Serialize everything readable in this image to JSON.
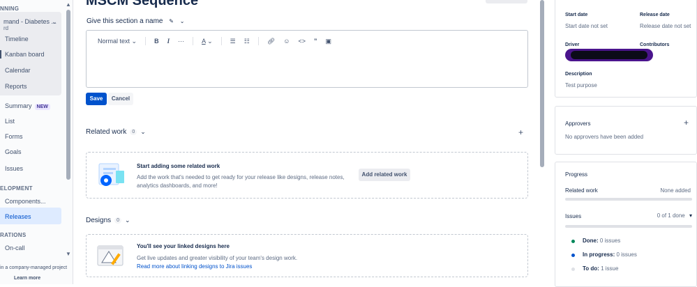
{
  "sidebar": {
    "section_planning": "NNING",
    "project_name": "mand - Diabetes ...",
    "project_sub": "rd",
    "items_plan": [
      {
        "label": "Timeline"
      },
      {
        "label": "Kanban board"
      },
      {
        "label": "Calendar"
      },
      {
        "label": "Reports"
      }
    ],
    "summary_label": "Summary",
    "summary_badge": "NEW",
    "items_more": [
      {
        "label": "List"
      },
      {
        "label": "Forms"
      },
      {
        "label": "Goals"
      },
      {
        "label": "Issues"
      }
    ],
    "section_development": "ELOPMENT",
    "components_label": "Components...",
    "releases_label": "Releases",
    "section_operations": "RATIONS",
    "oncall_label": "On-call",
    "footer_text": "in a company-managed project",
    "footer_link": "Learn more"
  },
  "main": {
    "title": "MSCM Sequence",
    "section_name_placeholder": "Give this section a name",
    "editor": {
      "text_style": "Normal text",
      "toolbar_icons": [
        "bold-icon",
        "italic-icon",
        "more-formatting-icon",
        "text-color-icon",
        "bullet-list-icon",
        "numbered-list-icon",
        "link-icon",
        "emoji-icon",
        "code-icon",
        "quote-icon",
        "date-icon"
      ]
    },
    "save_label": "Save",
    "cancel_label": "Cancel",
    "related_work": {
      "heading": "Related work",
      "count": "0",
      "title": "Start adding some related work",
      "body": "Add the work that's needed to get ready for your release like designs, release notes, analytics dashboards, and more!",
      "button": "Add related work"
    },
    "designs": {
      "heading": "Designs",
      "count": "0",
      "title": "You'll see your linked designs here",
      "body": "Get live updates and greater visibility of your team's design work.",
      "link": "Read more about linking designs to Jira issues"
    }
  },
  "details": {
    "start_date_label": "Start date",
    "start_date_value": "Start date not set",
    "release_date_label": "Release date",
    "release_date_value": "Release date not set",
    "driver_label": "Driver",
    "contributors_label": "Contributors",
    "description_label": "Description",
    "description_value": "Test purpose"
  },
  "approvers": {
    "heading": "Approvers",
    "empty": "No approvers have been added"
  },
  "progress": {
    "heading": "Progress",
    "related_work_label": "Related work",
    "related_work_value": "None added",
    "issues_label": "Issues",
    "issues_value": "0 of 1 done",
    "issues_fraction_done": 0,
    "done_label": "Done:",
    "done_value": "0 issues",
    "in_progress_label": "In progress:",
    "in_progress_value": "0 issues",
    "todo_label": "To do:",
    "todo_value": "1 issue",
    "colors": {
      "done": "#00875a",
      "in_progress": "#0052cc",
      "todo": "#dfe1e6"
    }
  }
}
